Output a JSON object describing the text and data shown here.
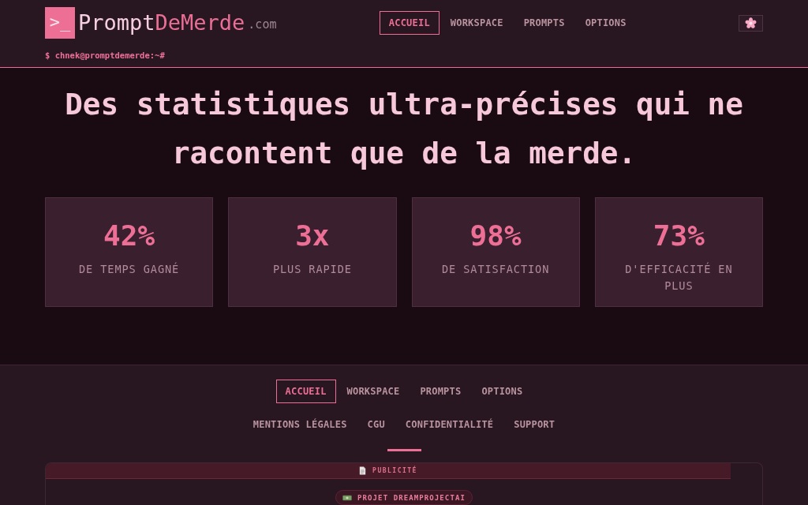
{
  "header": {
    "logo": {
      "mark": ">_",
      "name": "Prompt",
      "name_accent": "DeMerde",
      "domain": ".com"
    },
    "nav": [
      {
        "label": "ACCUEIL",
        "selected": true
      },
      {
        "label": "WORKSPACE",
        "selected": false
      },
      {
        "label": "PROMPTS",
        "selected": false
      },
      {
        "label": "OPTIONS",
        "selected": false
      }
    ],
    "prompt": "$ chnek@promptdemerde:~#"
  },
  "hero": {
    "title": "Des statistiques ultra-précises qui ne racontent que de la merde.",
    "stats": [
      {
        "value": "42%",
        "label": "DE TEMPS GAGNÉ"
      },
      {
        "value": "3x",
        "label": "PLUS RAPIDE"
      },
      {
        "value": "98%",
        "label": "DE SATISFACTION"
      },
      {
        "value": "73%",
        "label": "D'EFFICACITÉ EN PLUS"
      }
    ]
  },
  "footer": {
    "nav": [
      {
        "label": "ACCUEIL",
        "selected": true
      },
      {
        "label": "WORKSPACE",
        "selected": false
      },
      {
        "label": "PROMPTS",
        "selected": false
      },
      {
        "label": "OPTIONS",
        "selected": false
      }
    ],
    "links": [
      "MENTIONS LÉGALES",
      "CGU",
      "CONFIDENTIALITÉ",
      "SUPPORT"
    ],
    "ad": {
      "label": "PUBLICITÉ",
      "sponsor": "PROJET DREAMPROJECTAI"
    }
  }
}
